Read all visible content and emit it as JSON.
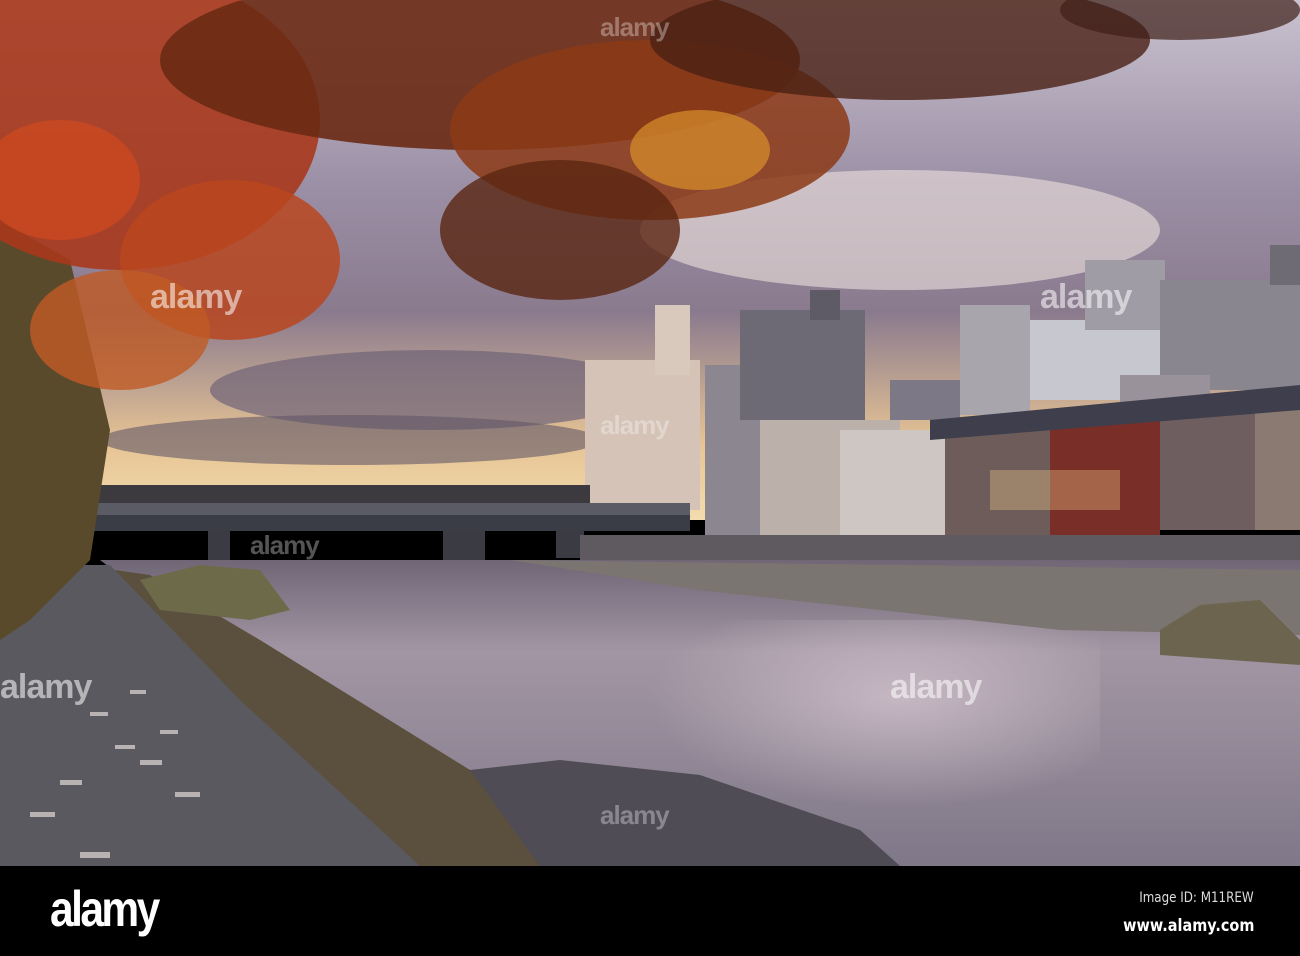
{
  "photo": {
    "subject": "Kamo River at sunset with autumn maple leaves",
    "colors": {
      "sky_top": "#8a7e92",
      "sky_horizon": "#f1d6a6",
      "water": "#8f8596",
      "foliage_red": "#a8381c",
      "foliage_orange": "#d8782a"
    }
  },
  "watermarks": [
    "alamy",
    "alamy",
    "alamy",
    "alamy",
    "alamy",
    "alamy",
    "alamy",
    "alamy"
  ],
  "footer": {
    "logo": "alamy",
    "image_id": "Image ID: M11REW",
    "website": "www.alamy.com"
  }
}
